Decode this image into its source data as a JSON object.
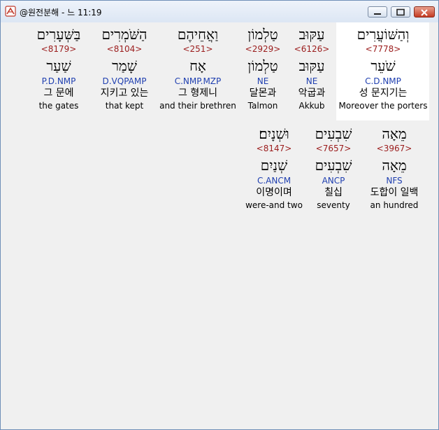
{
  "window": {
    "title": "@원전분해 - 느 11:19"
  },
  "words": [
    {
      "hebrew": "וְהַשּׁוֹעֲרִים",
      "strong": "<7778>",
      "lemma": "שֹׁעֵר",
      "morph": "C.D.NMP",
      "korean": "성 문지기는",
      "english": "Moreover the porters"
    },
    {
      "hebrew": "עַקּוּב",
      "strong": "<6126>",
      "lemma": "עַקּוּב",
      "morph": "NE",
      "korean": "악굽과",
      "english": "Akkub"
    },
    {
      "hebrew": "טַלְמוֹן",
      "strong": "<2929>",
      "lemma": "טַלְמוֹן",
      "morph": "NE",
      "korean": "달몬과",
      "english": "Talmon"
    },
    {
      "hebrew": "וַאֲחֵיהֶם",
      "strong": "<251>",
      "lemma": "אָח",
      "morph": "C.NMP.MZP",
      "korean": "그 형제니",
      "english": "and their brethren"
    },
    {
      "hebrew": "הַשֹּׁמְרִים",
      "strong": "<8104>",
      "lemma": "שָׁמַר",
      "morph": "D.VQPAMP",
      "korean": "지키고 있는",
      "english": "that kept"
    },
    {
      "hebrew": "בַּשְּׁעָרִים",
      "strong": "<8179>",
      "lemma": "שַׁעַר",
      "morph": "P.D.NMP",
      "korean": "그 문에",
      "english": "the gates"
    },
    {
      "hebrew": "מֵאָה",
      "strong": "<3967>",
      "lemma": "מֵאָה",
      "morph": "NFS",
      "korean": "도합이 일백",
      "english": "an hundred"
    },
    {
      "hebrew": "שִׁבְעִים",
      "strong": "<7657>",
      "lemma": "שִׁבְעִים",
      "morph": "ANCP",
      "korean": "칠십",
      "english": "seventy"
    },
    {
      "hebrew": "וּשְׁנָיִם׃",
      "strong": "<8147>",
      "lemma": "שְׁנַיִם",
      "morph": "C.ANCM",
      "korean": "이명이며",
      "english": "were-and two"
    }
  ]
}
